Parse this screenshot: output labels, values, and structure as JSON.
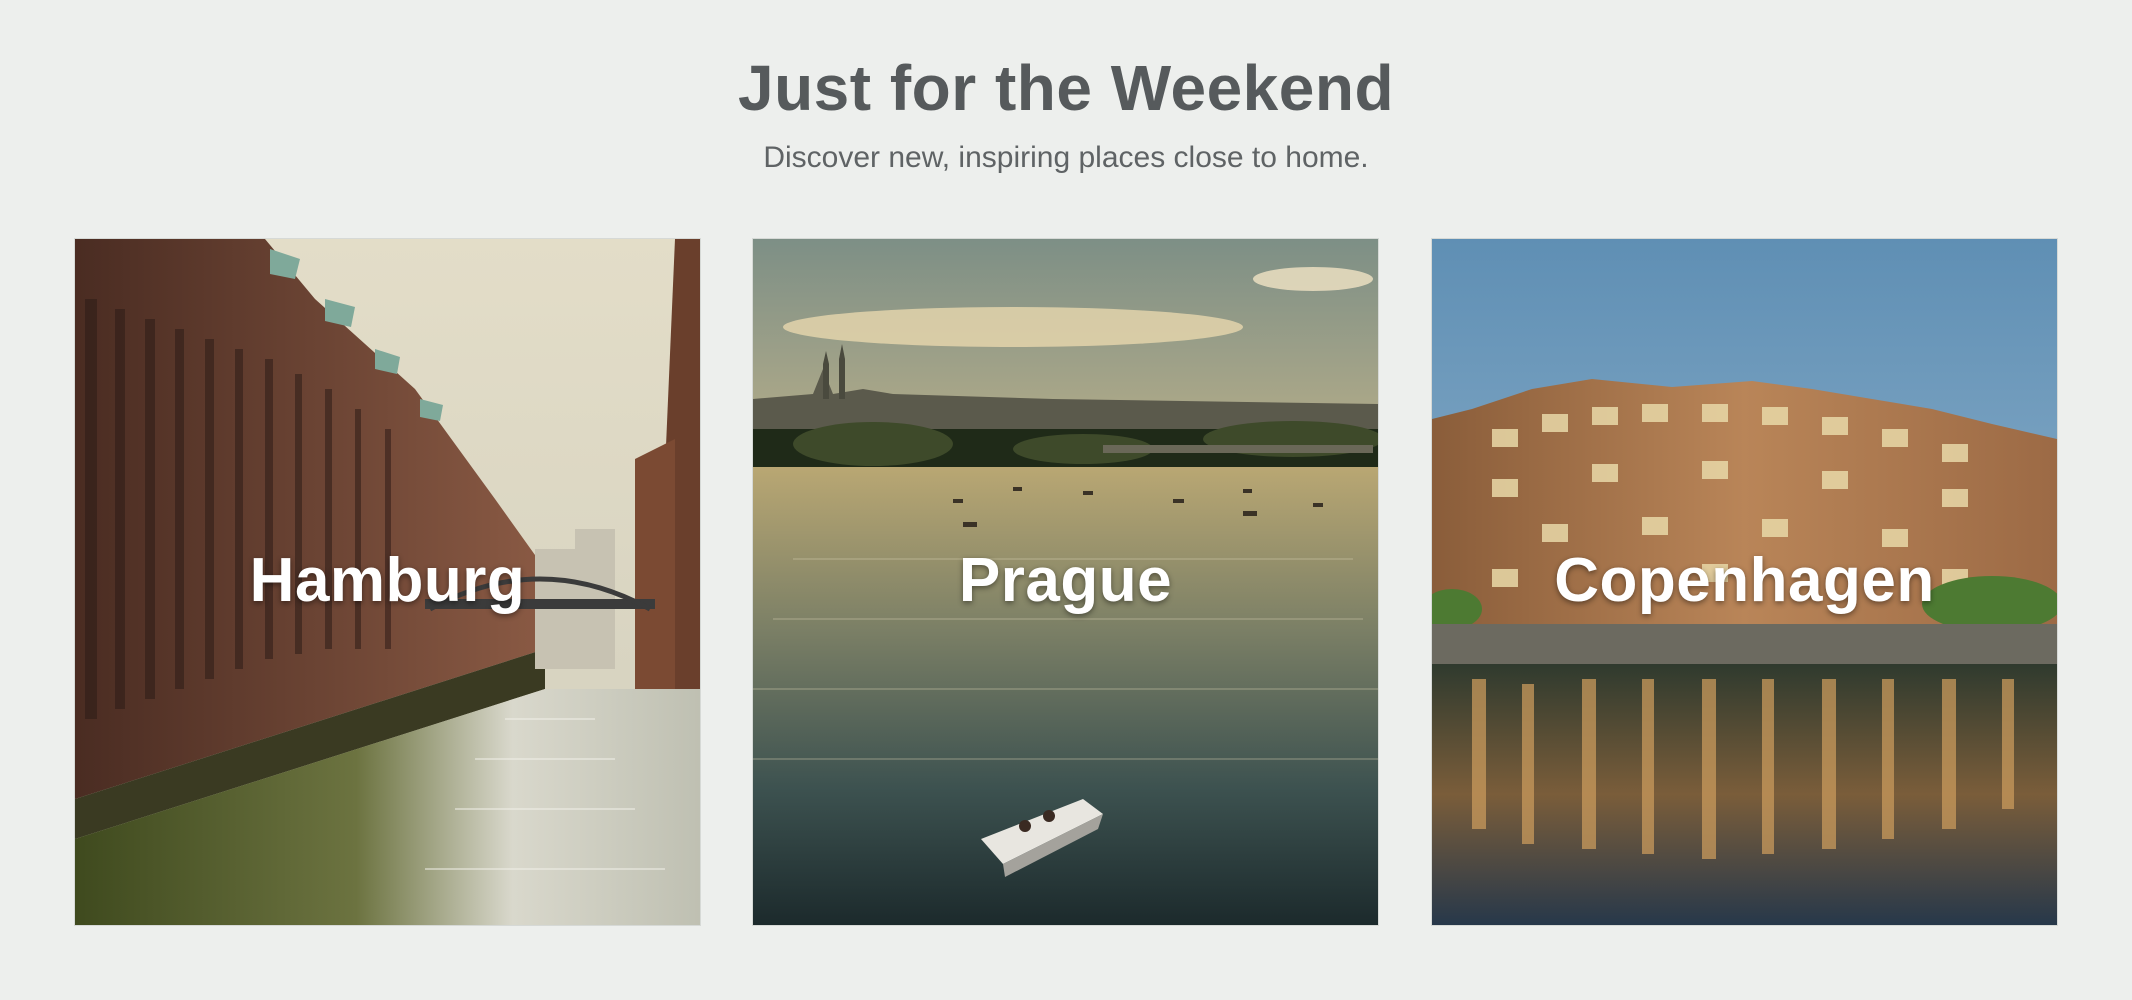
{
  "section": {
    "title": "Just for the Weekend",
    "subtitle": "Discover new, inspiring places close to home."
  },
  "destinations": [
    {
      "name": "Hamburg"
    },
    {
      "name": "Prague"
    },
    {
      "name": "Copenhagen"
    }
  ],
  "colors": {
    "background": "#edefed",
    "heading_text": "#565a5c",
    "card_label": "#ffffff"
  }
}
